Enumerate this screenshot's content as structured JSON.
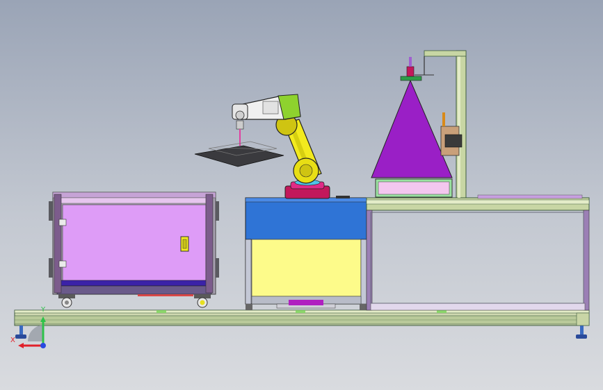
{
  "view": {
    "background_top": "#9aa4b6",
    "background_bottom": "#d9dbdf"
  },
  "triad": {
    "x_label": "X",
    "y_label": "Y",
    "x_color": "#e0202a",
    "y_color": "#2ec24a",
    "z_color": "#2a4ae0"
  },
  "colors": {
    "cabinet_panel": "#de9cf7",
    "cabinet_frame": "#7c5c8c",
    "base_top": "#2f74d6",
    "base_panel": "#fdfb8a",
    "robot_yellow": "#f2ea1e",
    "robot_green": "#8ed22e",
    "robot_base": "#d81e78",
    "cone": "#9a1fc6",
    "platform": "#9be3a2",
    "rail": "#c8d6a4",
    "tray": "#3a3a3e"
  },
  "icons": [
    "coordinate-triad-icon",
    "handle-icon",
    "caster-wheel-icon",
    "leveling-foot-icon"
  ]
}
